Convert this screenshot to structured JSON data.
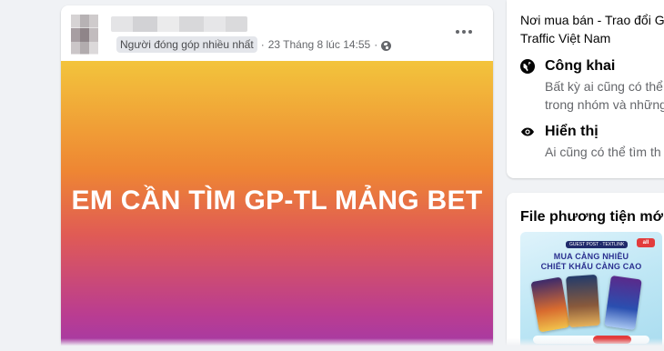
{
  "post": {
    "badge": "Người đóng góp nhiều nhất",
    "separator": "·",
    "timestamp": "23 Tháng 8 lúc 14:55",
    "separator2": "·",
    "privacy_icon": "globe-icon",
    "more_icon": "more-options-icon",
    "text": "EM CẦN TÌM GP-TL MẢNG BET",
    "background_gradient": [
      "#f3c43c",
      "#ee8633",
      "#e05b55",
      "#b93c92",
      "#a23aa7"
    ]
  },
  "about": {
    "group_name_line1": "Nơi mua bán - Trao đổi G",
    "group_name_line2": "Traffic Việt Nam",
    "privacy": {
      "icon": "globe-icon",
      "title": "Công khai",
      "desc_line1": "Bất kỳ ai cũng có thể",
      "desc_line2": "trong nhóm và những"
    },
    "visibility": {
      "icon": "eye-icon",
      "title": "Hiển thị",
      "desc_line1": "Ai cũng có thể tìm th"
    }
  },
  "media": {
    "title": "File phương tiện mới c",
    "thumbnail": {
      "tag": "GUEST POST · TEXTLINK",
      "logo": "all",
      "line1": "MUA CÀNG NHIỀU",
      "line2": "CHIẾT KHẤU CÀNG CAO"
    }
  },
  "colors": {
    "page_bg": "#f0f2f5",
    "card_bg": "#ffffff",
    "secondary_text": "#65676b"
  }
}
